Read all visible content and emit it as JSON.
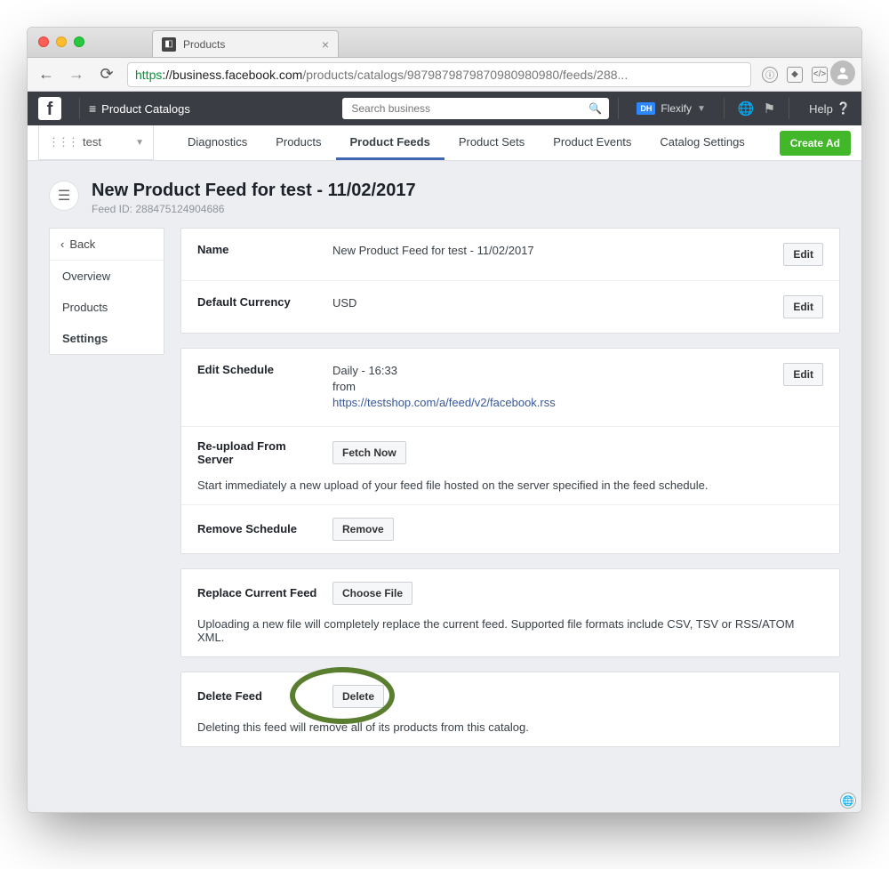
{
  "browser": {
    "tab_title": "Products",
    "url_scheme": "https",
    "url_host": "://business.facebook.com",
    "url_path": "/products/catalogs/98798798798709809809​80/feeds/288..."
  },
  "topbar": {
    "section": "Product Catalogs",
    "search_placeholder": "Search business",
    "user_badge": "DH",
    "user_label": "Flexify",
    "help": "Help"
  },
  "secondbar": {
    "catalog_name": "test",
    "tabs": [
      "Diagnostics",
      "Products",
      "Product Feeds",
      "Product Sets",
      "Product Events",
      "Catalog Settings"
    ],
    "active_tab": "Product Feeds",
    "create_ad": "Create Ad"
  },
  "page": {
    "title": "New Product Feed for test - 11/02/2017",
    "feed_id_label": "Feed ID: 288475124904686"
  },
  "side": {
    "back": "Back",
    "items": [
      "Overview",
      "Products",
      "Settings"
    ],
    "active": "Settings"
  },
  "card1": {
    "row0": {
      "label": "Name",
      "value": "New Product Feed for test - 11/02/2017",
      "btn": "Edit"
    },
    "row1": {
      "label": "Default Currency",
      "value": "USD",
      "btn": "Edit"
    }
  },
  "card2": {
    "schedule": {
      "label": "Edit Schedule",
      "line1": "Daily - 16:33",
      "line2": "from",
      "link": "https://testshop.com/a/feed/v2/facebook.rss",
      "btn": "Edit"
    },
    "reupload": {
      "label": "Re-upload From Server",
      "btn": "Fetch Now",
      "desc": "Start immediately a new upload of your feed file hosted on the server specified in the feed schedule."
    },
    "remove": {
      "label": "Remove Schedule",
      "btn": "Remove"
    }
  },
  "card3": {
    "replace": {
      "label": "Replace Current Feed",
      "btn": "Choose File",
      "desc": "Uploading a new file will completely replace the current feed. Supported file formats include CSV, TSV or RSS/ATOM XML."
    }
  },
  "card4": {
    "delete": {
      "label": "Delete Feed",
      "btn": "Delete",
      "desc": "Deleting this feed will remove all of its products from this catalog."
    }
  }
}
